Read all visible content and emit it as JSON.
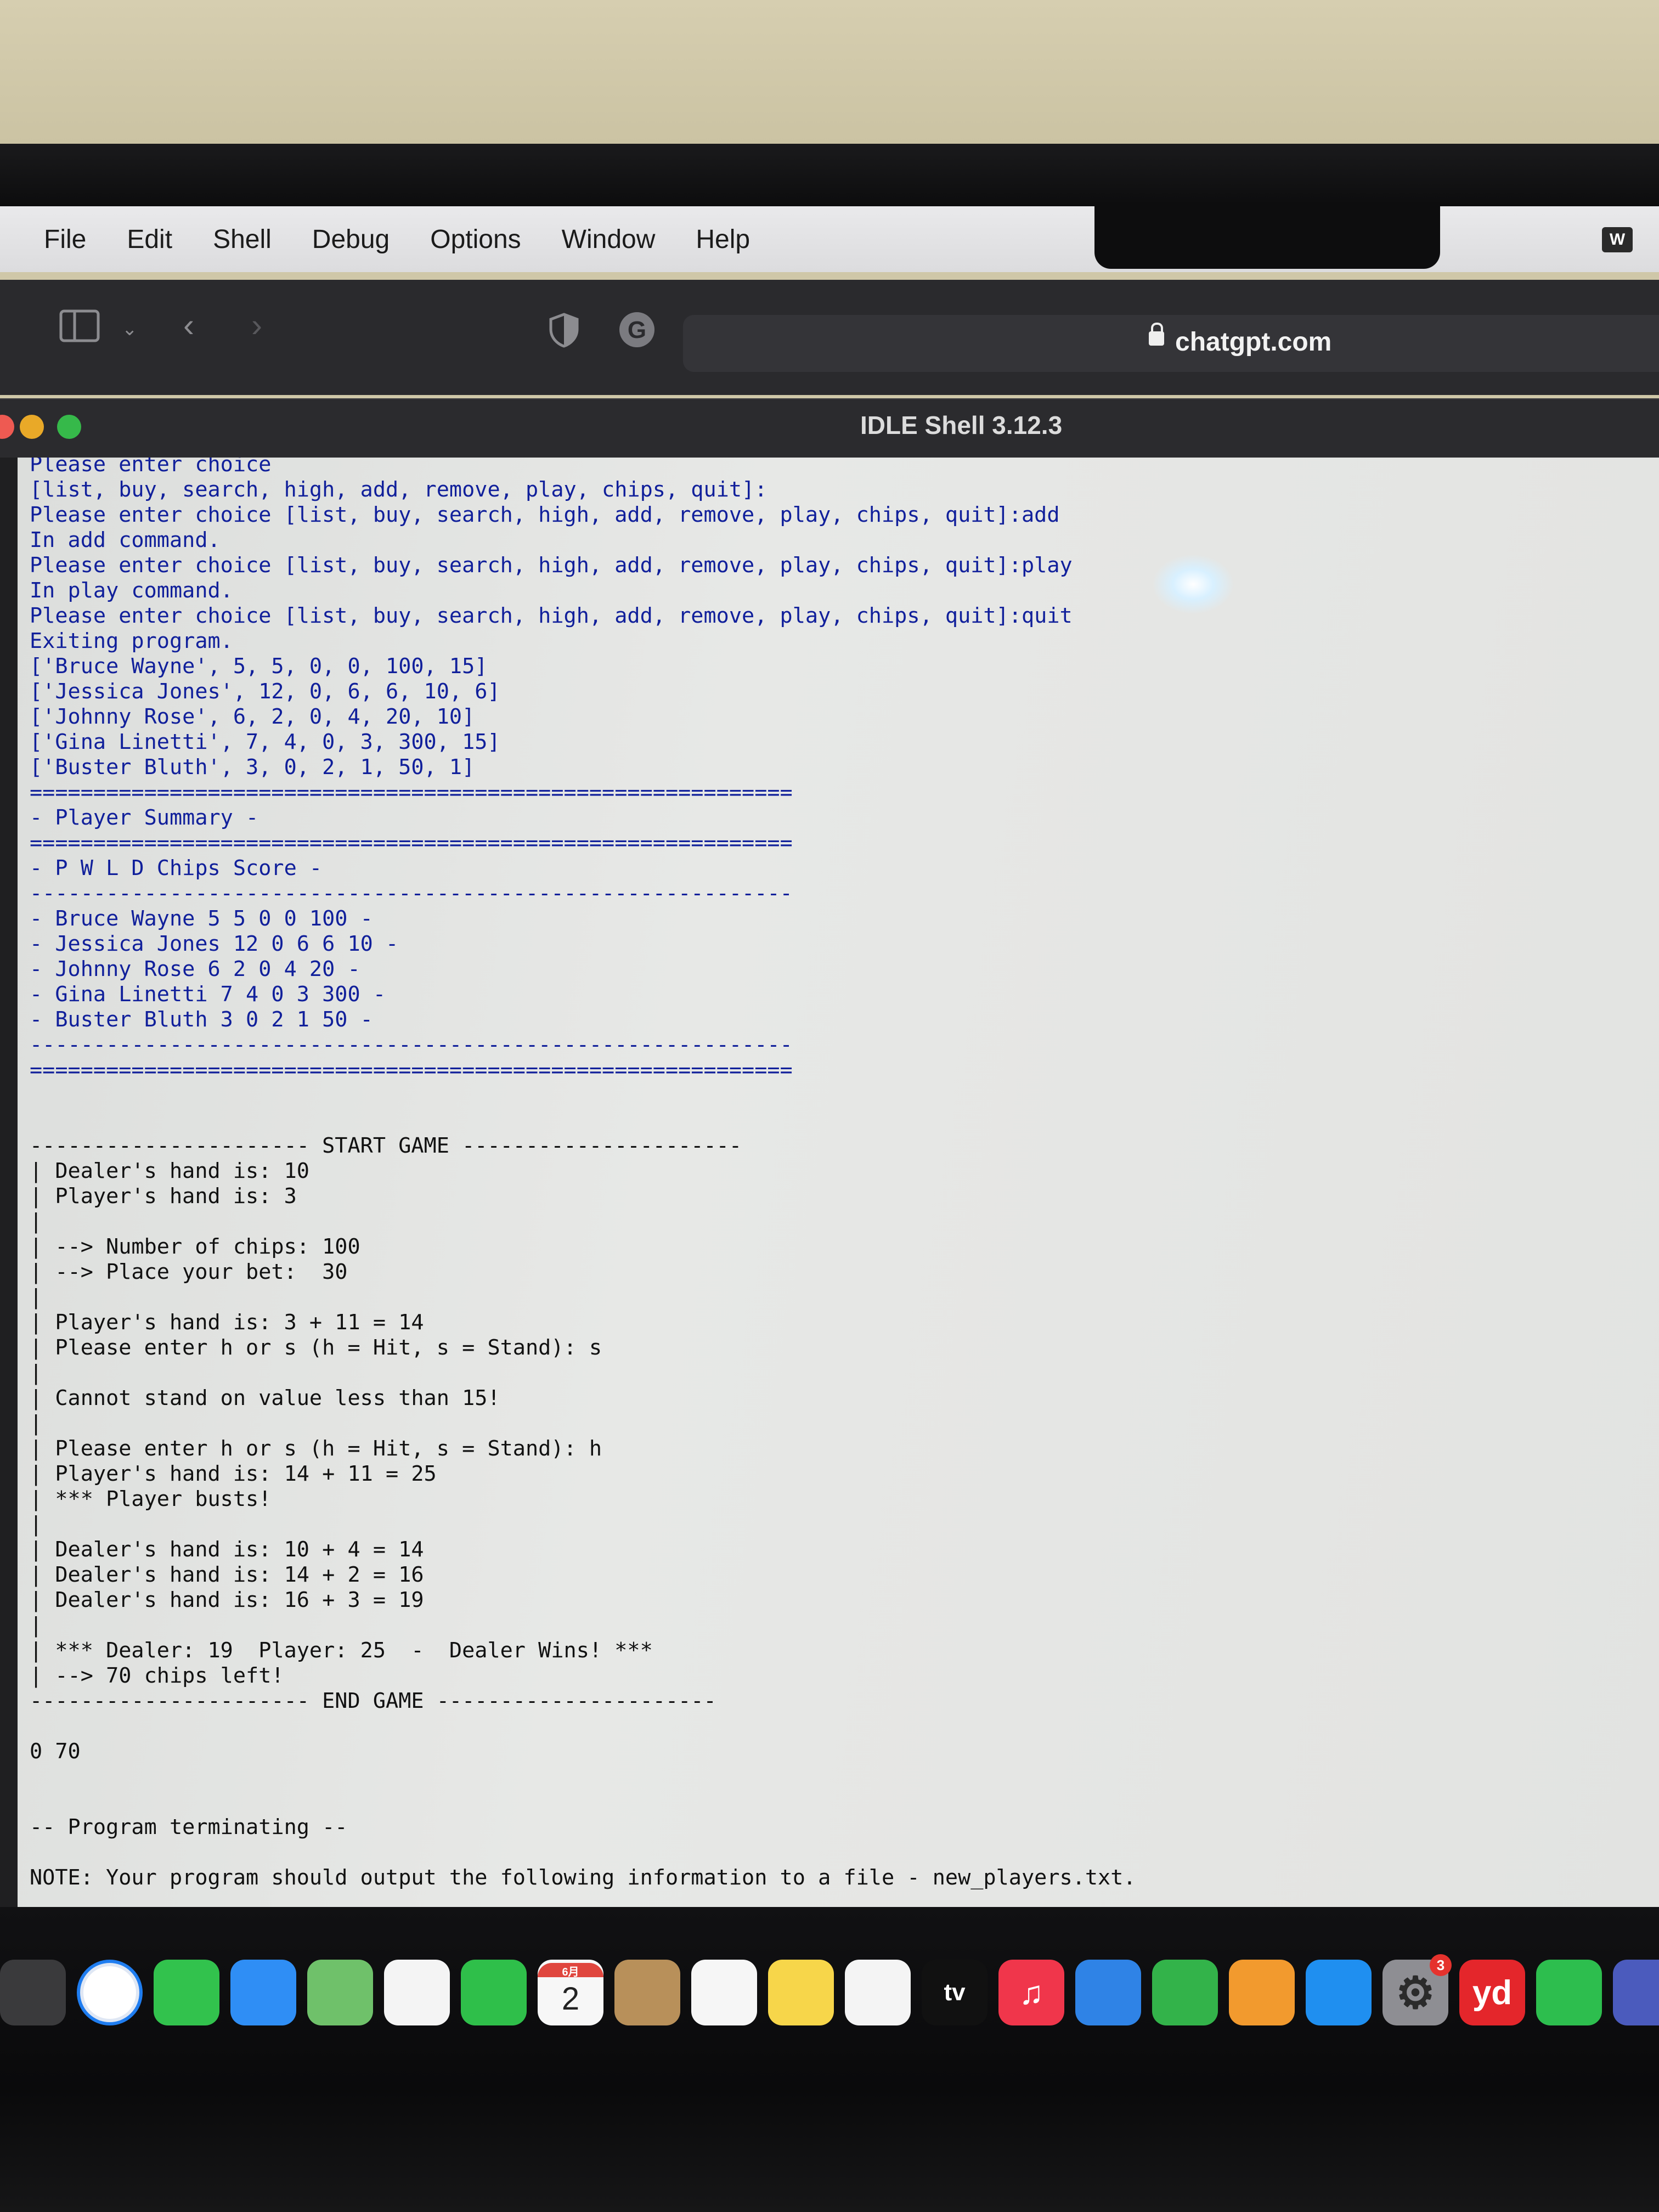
{
  "menubar": {
    "items": [
      "File",
      "Edit",
      "Shell",
      "Debug",
      "Options",
      "Window",
      "Help"
    ]
  },
  "browser": {
    "url": "chatgpt.com"
  },
  "window": {
    "title": "IDLE Shell 3.12.3"
  },
  "console": {
    "lines": [
      {
        "text": "Please enter choice",
        "kind": "out"
      },
      {
        "text": "[list, buy, search, high, add, remove, play, chips, quit]:",
        "kind": "out"
      },
      {
        "text": "Please enter choice [list, buy, search, high, add, remove, play, chips, quit]:add",
        "kind": "out"
      },
      {
        "text": "In add command.",
        "kind": "out"
      },
      {
        "text": "Please enter choice [list, buy, search, high, add, remove, play, chips, quit]:play",
        "kind": "out"
      },
      {
        "text": "In play command.",
        "kind": "out"
      },
      {
        "text": "Please enter choice [list, buy, search, high, add, remove, play, chips, quit]:quit",
        "kind": "out"
      },
      {
        "text": "Exiting program.",
        "kind": "out"
      },
      {
        "text": "['Bruce Wayne', 5, 5, 0, 0, 100, 15]",
        "kind": "out"
      },
      {
        "text": "['Jessica Jones', 12, 0, 6, 6, 10, 6]",
        "kind": "out"
      },
      {
        "text": "['Johnny Rose', 6, 2, 0, 4, 20, 10]",
        "kind": "out"
      },
      {
        "text": "['Gina Linetti', 7, 4, 0, 3, 300, 15]",
        "kind": "out"
      },
      {
        "text": "['Buster Bluth', 3, 0, 2, 1, 50, 1]",
        "kind": "out"
      },
      {
        "text": "============================================================",
        "kind": "out"
      },
      {
        "text": "- Player Summary -",
        "kind": "out"
      },
      {
        "text": "============================================================",
        "kind": "out"
      },
      {
        "text": "- P W L D Chips Score -",
        "kind": "out"
      },
      {
        "text": "------------------------------------------------------------",
        "kind": "out"
      },
      {
        "text": "- Bruce Wayne 5 5 0 0 100 -",
        "kind": "out"
      },
      {
        "text": "- Jessica Jones 12 0 6 6 10 -",
        "kind": "out"
      },
      {
        "text": "- Johnny Rose 6 2 0 4 20 -",
        "kind": "out"
      },
      {
        "text": "- Gina Linetti 7 4 0 3 300 -",
        "kind": "out"
      },
      {
        "text": "- Buster Bluth 3 0 2 1 50 -",
        "kind": "out"
      },
      {
        "text": "------------------------------------------------------------",
        "kind": "out"
      },
      {
        "text": "============================================================",
        "kind": "out"
      },
      {
        "text": "",
        "kind": "out"
      },
      {
        "text": "",
        "kind": "out"
      },
      {
        "text": "---------------------- START GAME ----------------------",
        "kind": "inp"
      },
      {
        "text": "| Dealer's hand is: 10",
        "kind": "inp"
      },
      {
        "text": "| Player's hand is: 3",
        "kind": "inp"
      },
      {
        "text": "|",
        "kind": "inp"
      },
      {
        "text": "| --> Number of chips: 100",
        "kind": "inp"
      },
      {
        "text": "| --> Place your bet:  30",
        "kind": "inp"
      },
      {
        "text": "|",
        "kind": "inp"
      },
      {
        "text": "| Player's hand is: 3 + 11 = 14",
        "kind": "inp"
      },
      {
        "text": "| Please enter h or s (h = Hit, s = Stand): s",
        "kind": "inp"
      },
      {
        "text": "|",
        "kind": "inp"
      },
      {
        "text": "| Cannot stand on value less than 15!",
        "kind": "inp"
      },
      {
        "text": "|",
        "kind": "inp"
      },
      {
        "text": "| Please enter h or s (h = Hit, s = Stand): h",
        "kind": "inp"
      },
      {
        "text": "| Player's hand is: 14 + 11 = 25",
        "kind": "inp"
      },
      {
        "text": "| *** Player busts!",
        "kind": "inp"
      },
      {
        "text": "|",
        "kind": "inp"
      },
      {
        "text": "| Dealer's hand is: 10 + 4 = 14",
        "kind": "inp"
      },
      {
        "text": "| Dealer's hand is: 14 + 2 = 16",
        "kind": "inp"
      },
      {
        "text": "| Dealer's hand is: 16 + 3 = 19",
        "kind": "inp"
      },
      {
        "text": "|",
        "kind": "inp"
      },
      {
        "text": "| *** Dealer: 19  Player: 25  -  Dealer Wins! ***",
        "kind": "inp"
      },
      {
        "text": "| --> 70 chips left!",
        "kind": "inp"
      },
      {
        "text": "---------------------- END GAME ----------------------",
        "kind": "inp"
      },
      {
        "text": "",
        "kind": "inp"
      },
      {
        "text": "0 70",
        "kind": "inp"
      },
      {
        "text": "",
        "kind": "inp"
      },
      {
        "text": "",
        "kind": "inp"
      },
      {
        "text": "-- Program terminating --",
        "kind": "inp"
      },
      {
        "text": "",
        "kind": "inp"
      },
      {
        "text": "NOTE: Your program should output the following information to a file - new_players.txt.",
        "kind": "inp"
      }
    ]
  },
  "dock": {
    "calendar_month": "6月",
    "calendar_day": "2",
    "tv_label": "tv",
    "youdao_label": "yd",
    "settings_badge": "3",
    "icons": [
      {
        "name": "launchpad-icon",
        "color": "#3a3a3c"
      },
      {
        "name": "safari-icon",
        "color": "#1f7df0"
      },
      {
        "name": "messages-icon",
        "color": "#32c24d"
      },
      {
        "name": "mail-icon",
        "color": "#2f8ef5"
      },
      {
        "name": "maps-icon",
        "color": "#6fc16a"
      },
      {
        "name": "photos-icon",
        "color": "#f4f4f4"
      },
      {
        "name": "facetime-icon",
        "color": "#2fbf4a"
      },
      {
        "name": "calendar-icon",
        "color": "#f7f7f7"
      },
      {
        "name": "contacts-icon",
        "color": "#b8905a"
      },
      {
        "name": "reminders-icon",
        "color": "#f6f6f6"
      },
      {
        "name": "notes-icon",
        "color": "#f7d64a"
      },
      {
        "name": "freeform-icon",
        "color": "#f4f4f4"
      },
      {
        "name": "appletv-icon",
        "color": "#111111"
      },
      {
        "name": "music-icon",
        "color": "#f0364b"
      },
      {
        "name": "keynote-icon",
        "color": "#2f83e6"
      },
      {
        "name": "numbers-icon",
        "color": "#33b34a"
      },
      {
        "name": "pages-icon",
        "color": "#f29a2e"
      },
      {
        "name": "appstore-icon",
        "color": "#1f8ff0"
      },
      {
        "name": "settings-icon",
        "color": "#8e8e93"
      },
      {
        "name": "youdao-icon",
        "color": "#e4262b"
      },
      {
        "name": "wechat-icon",
        "color": "#2dbe4e"
      },
      {
        "name": "teams-icon",
        "color": "#4b5bbd"
      }
    ]
  }
}
